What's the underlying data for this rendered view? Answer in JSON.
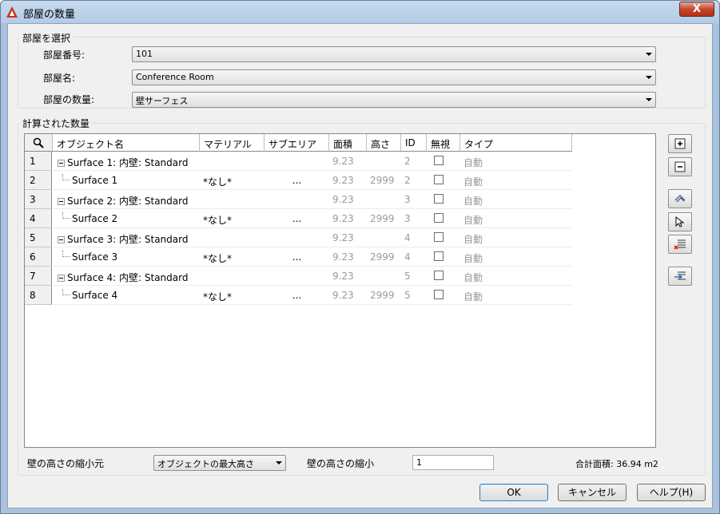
{
  "window": {
    "title": "部屋の数量",
    "close_label": "X"
  },
  "select_group": {
    "label": "部屋を選択",
    "room_number_label": "部屋番号:",
    "room_number_value": "101",
    "room_name_label": "部屋名:",
    "room_name_value": "Conference Room",
    "quantity_label": "部屋の数量:",
    "quantity_value": "壁サーフェス"
  },
  "calc_group": {
    "label": "計算された数量"
  },
  "grid": {
    "headers": [
      "オブジェクト名",
      "マテリアル",
      "サブエリア",
      "面積",
      "高さ",
      "ID",
      "無視",
      "タイプ"
    ],
    "rows": [
      {
        "num": "1",
        "name": "Surface 1: 内壁: Standard",
        "parent": true,
        "material": "",
        "subarea": "",
        "area": "9.23",
        "height": "",
        "id": "2",
        "type": "自動"
      },
      {
        "num": "2",
        "name": "Surface 1",
        "parent": false,
        "material": "*なし*",
        "subarea": "...",
        "area": "9.23",
        "height": "2999",
        "id": "2",
        "type": "自動"
      },
      {
        "num": "3",
        "name": "Surface 2: 内壁: Standard",
        "parent": true,
        "material": "",
        "subarea": "",
        "area": "9.23",
        "height": "",
        "id": "3",
        "type": "自動"
      },
      {
        "num": "4",
        "name": "Surface 2",
        "parent": false,
        "material": "*なし*",
        "subarea": "...",
        "area": "9.23",
        "height": "2999",
        "id": "3",
        "type": "自動"
      },
      {
        "num": "5",
        "name": "Surface 3: 内壁: Standard",
        "parent": true,
        "material": "",
        "subarea": "",
        "area": "9.23",
        "height": "",
        "id": "4",
        "type": "自動"
      },
      {
        "num": "6",
        "name": "Surface 3",
        "parent": false,
        "material": "*なし*",
        "subarea": "...",
        "area": "9.23",
        "height": "2999",
        "id": "4",
        "type": "自動"
      },
      {
        "num": "7",
        "name": "Surface 4: 内壁: Standard",
        "parent": true,
        "material": "",
        "subarea": "",
        "area": "9.23",
        "height": "",
        "id": "5",
        "type": "自動"
      },
      {
        "num": "8",
        "name": "Surface 4",
        "parent": false,
        "material": "*なし*",
        "subarea": "...",
        "area": "9.23",
        "height": "2999",
        "id": "5",
        "type": "自動"
      }
    ]
  },
  "bottom": {
    "wall_height_source_label": "壁の高さの縮小元",
    "wall_height_source_value": "オブジェクトの最大高さ",
    "wall_height_scale_label": "壁の高さの縮小",
    "wall_height_scale_value": "1",
    "total_area": "合計面積: 36.94 m2"
  },
  "buttons": {
    "ok": "OK",
    "cancel": "キャンセル",
    "help": "ヘルプ(H)"
  },
  "icons": [
    "search-icon",
    "expand-all-icon",
    "collapse-all-icon",
    "select-objects-icon",
    "pick-icon",
    "delete-rows-icon",
    "insert-row-icon"
  ]
}
